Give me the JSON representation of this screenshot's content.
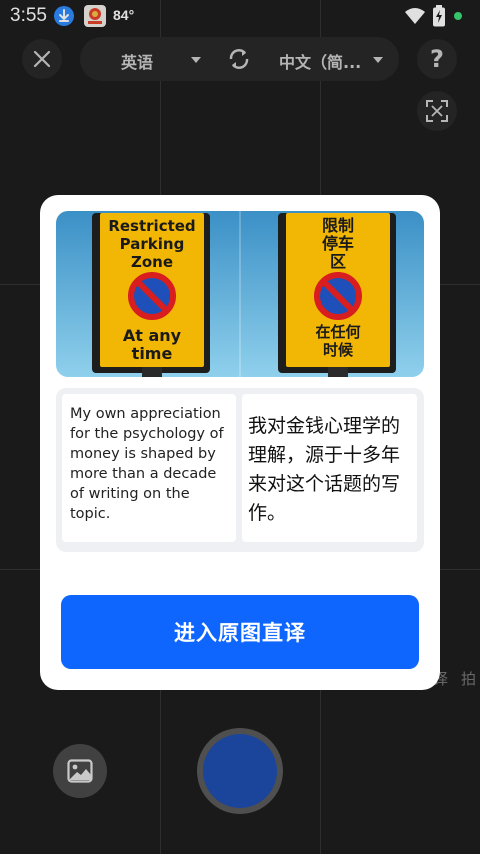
{
  "status_bar": {
    "time": "3:55",
    "temperature": "84°"
  },
  "top_bar": {
    "source_language": "英语",
    "target_language": "中文（简...",
    "help_label": "?"
  },
  "dialog": {
    "image": {
      "left_sign": [
        "Restricted",
        "Parking",
        "Zone",
        "At any",
        "time"
      ],
      "right_sign": [
        "限制",
        "停车",
        "区",
        "在任何",
        "时候"
      ]
    },
    "source_text": "My own appreciation for the psychology of money is shaped by more than a decade of writing on the topic.",
    "translated_text": "我对金钱心理学的理解，源于十多年来对这个话题的写作。",
    "enter_button": "进入原图直译"
  },
  "bottom_bar": {
    "right_label_partial": "拍",
    "right_label_fragment": "译"
  },
  "colors": {
    "accent": "#0e66ff",
    "shutter": "#1e4fb0",
    "sign_yellow": "#f2b705",
    "sign_red": "#d81e1e",
    "sign_blue": "#1f4fb8"
  }
}
